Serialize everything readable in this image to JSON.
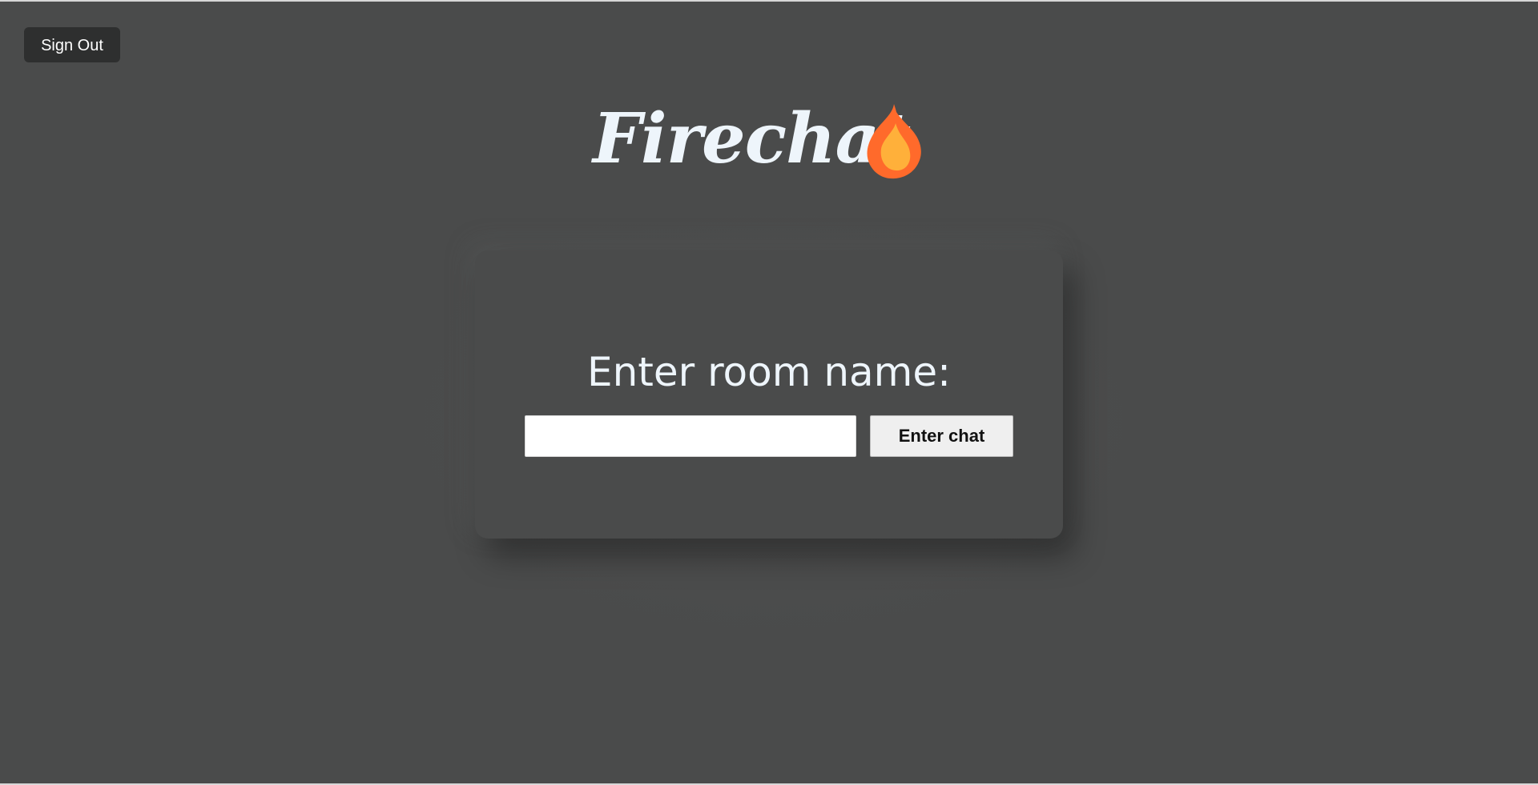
{
  "header": {
    "sign_out_label": "Sign Out"
  },
  "brand": {
    "name": "Firechat",
    "icon": "flame-icon",
    "text_color": "#eef5fb",
    "flame_outer_color": "#ff6a2b",
    "flame_inner_color": "#ffb03a"
  },
  "room_card": {
    "title": "Enter room name:",
    "room_input": {
      "value": "",
      "placeholder": ""
    },
    "enter_button_label": "Enter chat"
  },
  "colors": {
    "background": "#4a4b4b",
    "card": "#4a4b4b",
    "sign_out_button": "#2e2f2f",
    "enter_button": "#efefef"
  }
}
